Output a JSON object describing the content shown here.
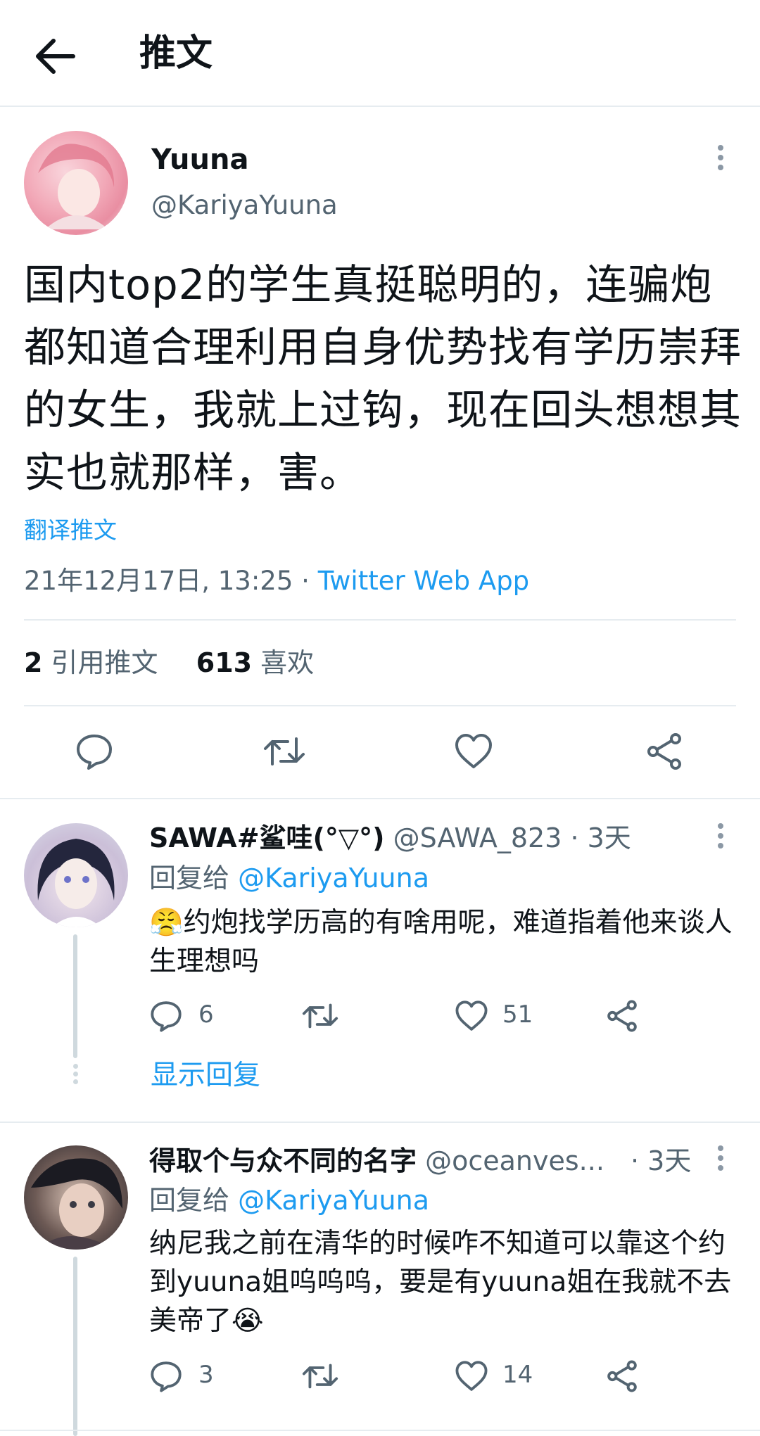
{
  "header": {
    "title": "推文"
  },
  "tweet": {
    "display_name": "Yuuna",
    "handle": "@KariyaYuuna",
    "text": "国内top2的学生真挺聪明的，连骗炮都知道合理利用自身优势找有学历崇拜的女生，我就上过钩，现在回头想想其实也就那样，害。",
    "translate": "翻译推文",
    "timestamp": "21年12月17日, 13:25 ·",
    "source": "Twitter Web App",
    "quotes_count": "2",
    "quotes_label": "引用推文",
    "likes_count": "613",
    "likes_label": "喜欢"
  },
  "replies": [
    {
      "display_name": "SAWA#鲨哇(°▽°)",
      "handle": "@SAWA_823",
      "time": "· 3天",
      "reply_to_label": "回复给",
      "reply_to_handle": "@KariyaYuuna",
      "emoji": "😤",
      "text": "约炮找学历高的有啥用呢，难道指着他来谈人生理想吗",
      "reply_count": "6",
      "like_count": "51",
      "show_replies": "显示回复"
    },
    {
      "display_name": "得取个与众不同的名字",
      "handle": "@oceanves...",
      "time": "· 3天",
      "reply_to_label": "回复给",
      "reply_to_handle": "@KariyaYuuna",
      "text": "纳尼我之前在清华的时候咋不知道可以靠这个约到yuuna姐呜呜呜，要是有yuuna姐在我就不去美帝了",
      "emoji": "😭",
      "reply_count": "3",
      "like_count": "14"
    }
  ],
  "colors": {
    "accent": "#1d9bf0",
    "secondary": "#536471",
    "divider": "#e6ecf0"
  }
}
